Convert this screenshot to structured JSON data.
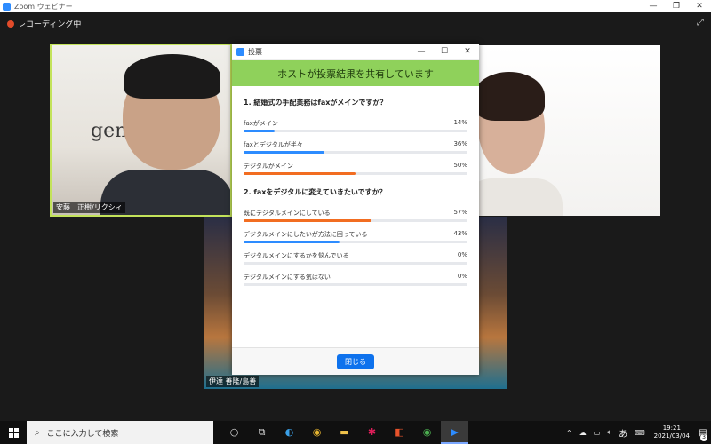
{
  "window": {
    "title": "Zoom ウェビナー",
    "controls": [
      "—",
      "❐",
      "✕"
    ]
  },
  "recording": {
    "label": "レコーディング中"
  },
  "participants": [
    {
      "name": "安藤　正樹/リクシィ",
      "logo_text": "gense"
    },
    {
      "name": ""
    },
    {
      "name": "伊達 善隆/島善"
    }
  ],
  "poll": {
    "window_title": "投票",
    "controls": [
      "—",
      "☐",
      "✕"
    ],
    "banner": "ホストが投票結果を共有しています",
    "questions": [
      {
        "title": "1. 結婚式の手配業務はfaxがメインですか？",
        "answers": [
          {
            "label": "faxがメイン",
            "percent_text": "14%",
            "percent": 14,
            "color": "#2d8cff"
          },
          {
            "label": "faxとデジタルが半々",
            "percent_text": "36%",
            "percent": 36,
            "color": "#2d8cff"
          },
          {
            "label": "デジタルがメイン",
            "percent_text": "50%",
            "percent": 50,
            "color": "#f26d21"
          }
        ]
      },
      {
        "title": "2. faxをデジタルに変えていきたいですか？",
        "answers": [
          {
            "label": "既にデジタルメインにしている",
            "percent_text": "57%",
            "percent": 57,
            "color": "#f26d21"
          },
          {
            "label": "デジタルメインにしたいが方法に困っている",
            "percent_text": "43%",
            "percent": 43,
            "color": "#2d8cff"
          },
          {
            "label": "デジタルメインにするかを悩んでいる",
            "percent_text": "0%",
            "percent": 0,
            "color": "#2d8cff"
          },
          {
            "label": "デジタルメインにする気はない",
            "percent_text": "0%",
            "percent": 0,
            "color": "#2d8cff"
          }
        ]
      }
    ],
    "close_label": "閉じる"
  },
  "taskbar": {
    "search_placeholder": "ここに入力して検索",
    "apps": [
      "cortana-icon",
      "task-view-icon",
      "edge-icon",
      "chrome-icon",
      "file-explorer-icon",
      "slack-icon",
      "office-icon",
      "chrome-icon-2",
      "zoom-icon"
    ],
    "ime": "あ",
    "time": "19:21",
    "date": "2021/03/04",
    "notifications": "3"
  },
  "colors": {
    "banner": "#8fd15b",
    "blue": "#2d8cff",
    "orange": "#f26d21",
    "button": "#0e72ed"
  }
}
